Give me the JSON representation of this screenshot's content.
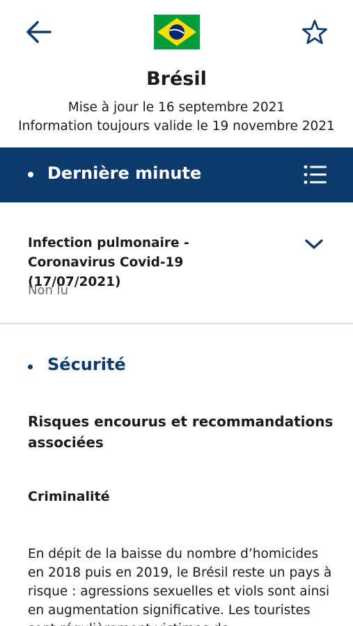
{
  "header": {
    "back_icon": "arrow-left-icon",
    "flag_icon": "brazil-flag-icon",
    "favorite_icon": "star-outline-icon",
    "country": "Brésil",
    "updated": "Mise à jour le 16 septembre 2021",
    "valid": "Information toujours valide le 19 novembre 2021"
  },
  "banner": {
    "title": "Dernière minute",
    "menu_icon": "list-menu-icon",
    "background": "#0c3b6b"
  },
  "latest": {
    "title": "Infection pulmonaire - Coronavirus Covid-19 (17/07/2021)",
    "status": "Non lu",
    "expand_icon": "chevron-down-icon"
  },
  "security": {
    "title": "Sécurité",
    "subheading": "Risques encourus et recommandations associées",
    "crime_heading": "Criminalité",
    "paragraph": "En dépit de la baisse du nombre d’homicides en 2018 puis en 2019, le Brésil reste un pays à risque : agressions sexuelles et viols sont ainsi en augmentation significative. Les touristes sont régulièrement victimes de"
  },
  "colors": {
    "accent": "#0c3b6b",
    "flag_green": "#009b3a",
    "flag_yellow": "#fedf00",
    "flag_blue": "#002776"
  }
}
